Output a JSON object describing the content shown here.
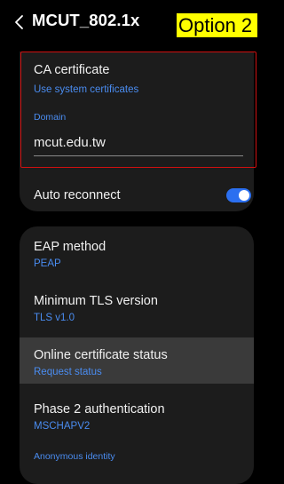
{
  "header": {
    "title": "MCUT_802.1x",
    "overlay_label": "Option 2"
  },
  "ca_certificate": {
    "label": "CA certificate",
    "value": "Use system certificates"
  },
  "domain": {
    "label": "Domain",
    "value": "mcut.edu.tw"
  },
  "auto_reconnect": {
    "label": "Auto reconnect",
    "enabled": true
  },
  "eap_method": {
    "label": "EAP method",
    "value": "PEAP"
  },
  "min_tls": {
    "label": "Minimum TLS version",
    "value": "TLS v1.0"
  },
  "online_cert": {
    "label": "Online certificate status",
    "value": "Request status"
  },
  "phase2": {
    "label": "Phase 2 authentication",
    "value": "MSCHAPV2"
  },
  "anon_identity": {
    "label": "Anonymous identity"
  },
  "colors": {
    "accent": "#4a8cf0",
    "toggle_on": "#2b6ff0",
    "highlight": "#ffff00",
    "focus_border": "#d01010"
  }
}
